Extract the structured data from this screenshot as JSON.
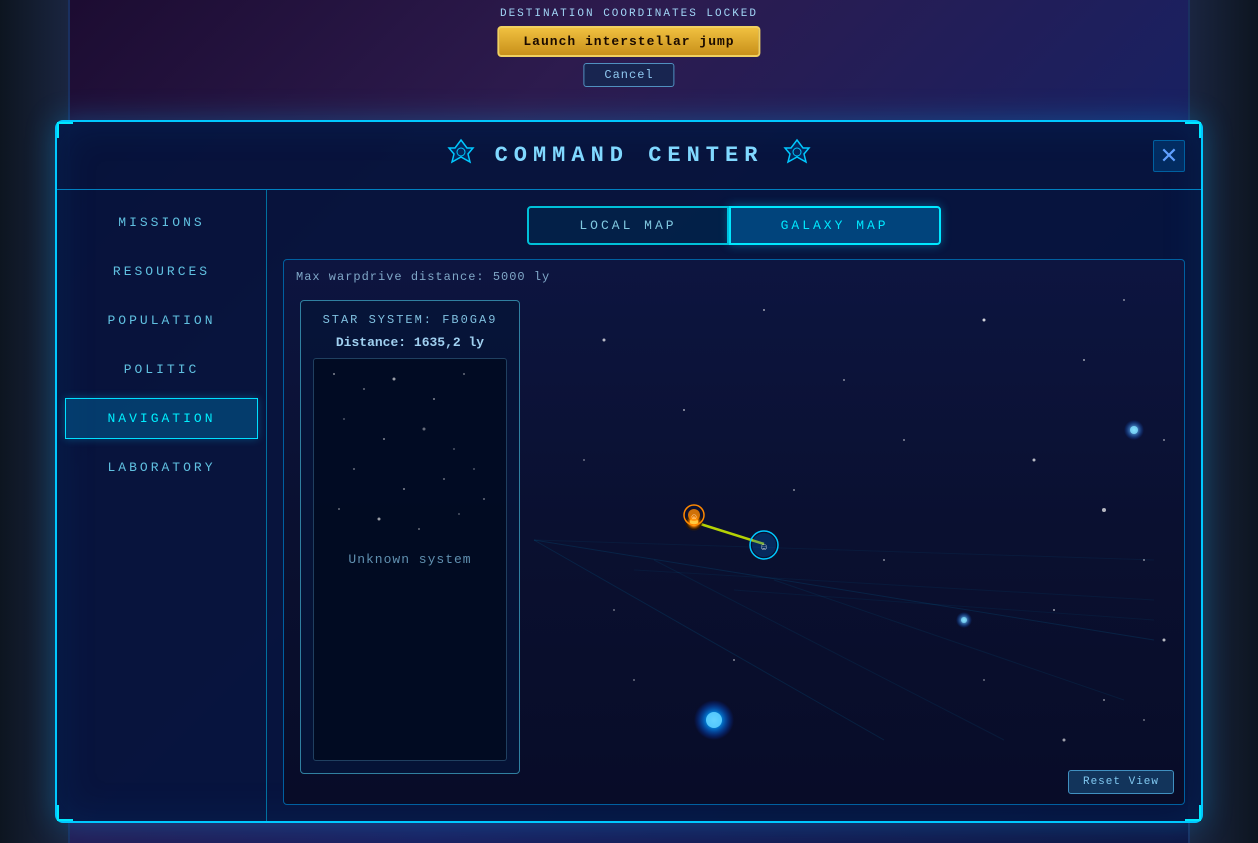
{
  "notification": {
    "destination_locked": "DESTINATION COORDINATES LOCKED",
    "launch_button": "Launch interstellar jump",
    "cancel_button": "Cancel"
  },
  "panel": {
    "title": "COMMAND CENTER",
    "close_label": "✕",
    "emblem_left": "⌖",
    "emblem_right": "⌖"
  },
  "sidebar": {
    "items": [
      {
        "label": "MISSIONS",
        "active": false
      },
      {
        "label": "RESOURCES",
        "active": false
      },
      {
        "label": "POPULATION",
        "active": false
      },
      {
        "label": "POLITIC",
        "active": false
      },
      {
        "label": "NAVIGATION",
        "active": true
      },
      {
        "label": "LABORATORY",
        "active": false
      }
    ]
  },
  "tabs": [
    {
      "label": "LOCAL MAP",
      "active": false
    },
    {
      "label": "GALAXY MAP",
      "active": true
    }
  ],
  "map": {
    "info_bar": "Max warpdrive distance: 5000 ly",
    "reset_view_label": "Reset View"
  },
  "system_card": {
    "title": "STAR SYSTEM: FB0GA9",
    "distance": "Distance: 1635,2 ly",
    "unknown_system_text": "Unknown system"
  }
}
